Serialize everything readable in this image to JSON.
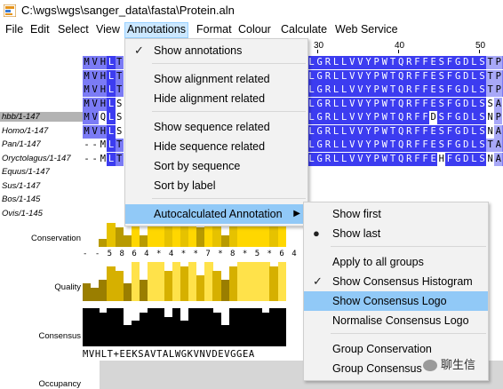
{
  "window": {
    "title": "C:\\wgs\\wgs\\sanger_data\\fasta\\Protein.aln"
  },
  "menubar": {
    "items": [
      "File",
      "Edit",
      "Select",
      "View",
      "Annotations",
      "Format",
      "Colour",
      "Calculate",
      "Web Service"
    ],
    "active": "Annotations"
  },
  "ruler": {
    "labels": [
      "30",
      "40",
      "50"
    ]
  },
  "sequences": [
    {
      "id": "hbb/1-147",
      "left": "MVHLT",
      "right": "LGRLLVVYPWTQRFFESFGDLSTPD",
      "selected": true
    },
    {
      "id": "Homo/1-147",
      "left": "MVHLT",
      "right": "LGRLLVVYPWTQRFFESFGDLSTPD",
      "selected": false
    },
    {
      "id": "Pan/1-147",
      "left": "MVHLT",
      "right": "LGRLLVVYPWTQRFFESFGDLSTPD",
      "selected": false
    },
    {
      "id": "Oryctolagus/1-147",
      "left": "MVHLS",
      "right": "LGRLLVVYPWTQRFFESFGDLSSAN",
      "selected": false
    },
    {
      "id": "Equus/1-147",
      "left": "MVQLS",
      "right": "LGRLLVVYPWTQRFFDSFGDLSNPG",
      "selected": false
    },
    {
      "id": "Sus/1-147",
      "left": "MVHLS",
      "right": "LGRLLVVYPWTQRFFESFGDLSNAD",
      "selected": false
    },
    {
      "id": "Bos/1-145",
      "left": "--MLT",
      "right": "LGRLLVVYPWTQRFFESFGDLSTAD",
      "selected": false
    },
    {
      "id": "Ovis/1-145",
      "left": "--MLT",
      "right": "LGRLLVVYPWTQRFFEHFGDLSNAD",
      "selected": false
    }
  ],
  "annotations": {
    "conservation_label": "Conservation",
    "conservation_dots": "- - 5 8 6 4 * 4 * * 7 * 8 * 5 * 6 4 9 * * * * + * *",
    "quality_label": "Quality",
    "consensus_label": "Consensus",
    "consensus_seq": "MVHLT+EEKSAVTALWGKVNVDEVGGEA",
    "occupancy_label": "Occupancy",
    "conservation_levels": [
      0,
      0,
      2,
      6,
      5,
      3,
      9,
      3,
      9,
      9,
      7,
      9,
      7,
      9,
      5,
      9,
      6,
      3,
      8,
      9,
      9,
      9,
      9,
      8,
      9
    ],
    "quality_levels": [
      4,
      3,
      5,
      8,
      7,
      4,
      9,
      5,
      9,
      9,
      7,
      9,
      8,
      9,
      6,
      9,
      7,
      5,
      8,
      9,
      9,
      9,
      9,
      8,
      9
    ],
    "consensus_levels": [
      9,
      9,
      8,
      9,
      9,
      5,
      6,
      8,
      9,
      9,
      7,
      9,
      6,
      9,
      9,
      9,
      8,
      5,
      9,
      9,
      9,
      9,
      8,
      9,
      9
    ]
  },
  "annotations_menu": {
    "items": [
      {
        "label": "Show annotations",
        "mark": "check"
      },
      {
        "label": "Show alignment related",
        "mark": ""
      },
      {
        "label": "Hide alignment related",
        "mark": ""
      },
      {
        "label": "Show sequence related",
        "mark": ""
      },
      {
        "label": "Hide sequence related",
        "mark": ""
      },
      {
        "label": "Sort by sequence",
        "mark": ""
      },
      {
        "label": "Sort by label",
        "mark": ""
      },
      {
        "label": "Autocalculated Annotation",
        "mark": "",
        "submenu": true,
        "highlighted": true
      }
    ]
  },
  "submenu": {
    "items": [
      {
        "label": "Show first",
        "mark": ""
      },
      {
        "label": "Show last",
        "mark": "bullet"
      },
      {
        "label": "Apply to all groups",
        "mark": ""
      },
      {
        "label": "Show Consensus Histogram",
        "mark": "check"
      },
      {
        "label": "Show Consensus Logo",
        "mark": "",
        "highlighted": true
      },
      {
        "label": "Normalise Consensus Logo",
        "mark": ""
      },
      {
        "label": "Group Conservation",
        "mark": ""
      },
      {
        "label": "Group Consensus",
        "mark": ""
      }
    ]
  },
  "watermark": {
    "text": "聊生信"
  },
  "colors": {
    "menu_highlight": "#91c9f7",
    "residue_dark": "#3c3cf0",
    "residue_mid": "#7b7bf5",
    "conservation": "#ffd700",
    "quality_dark": "#c8a000"
  }
}
